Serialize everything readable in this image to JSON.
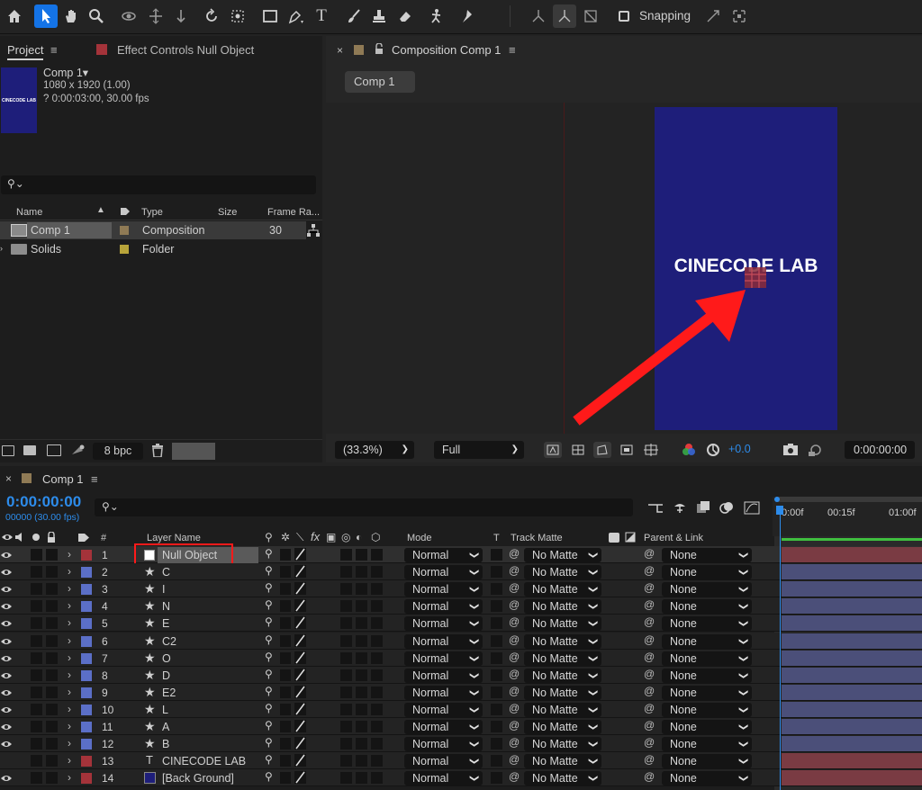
{
  "toolbar": {
    "snapping_label": "Snapping",
    "tools": [
      "home-icon",
      "selection-icon",
      "hand-icon",
      "zoom-icon",
      "orbit-icon",
      "pan-icon",
      "dolly-icon",
      "rotate-icon",
      "anchor-icon",
      "rectangle-icon",
      "pen-icon",
      "type-icon",
      "brush-icon",
      "clone-stamp-icon",
      "eraser-icon",
      "roto-brush-icon",
      "puppet-pin-icon"
    ]
  },
  "project_panel": {
    "tab_project": "Project",
    "tab_effect_controls": "Effect Controls Null Object",
    "thumb_text": "CINECODE LAB",
    "comp_name": "Comp 1▾",
    "comp_dims": "1080 x 1920 (1.00)",
    "comp_duration": "? 0:00:03:00, 30.00 fps",
    "search_placeholder": "",
    "columns": {
      "name": "Name",
      "type": "Type",
      "size": "Size",
      "frame_rate": "Frame Ra..."
    },
    "items": [
      {
        "name": "Comp 1",
        "type": "Composition",
        "frame_rate": "30"
      },
      {
        "name": "Solids",
        "type": "Folder",
        "frame_rate": ""
      }
    ],
    "bpc": "8 bpc"
  },
  "composition_panel": {
    "tab_title": "Composition Comp 1",
    "breadcrumb": "Comp 1",
    "overlay_text": "CINECODE LAB",
    "zoom": "(33.3%)",
    "resolution": "Full",
    "exposure": "+0.0",
    "timecode": "0:00:00:00"
  },
  "timeline": {
    "tab_title": "Comp 1",
    "current_time": "0:00:00:00",
    "frame_info": "00000 (30.00 fps)",
    "ruler": [
      "0:00f",
      "00:15f",
      "01:00f"
    ],
    "columns": {
      "num": "#",
      "layer_name": "Layer Name",
      "mode": "Mode",
      "t": "T",
      "track_matte": "Track Matte",
      "parent": "Parent & Link"
    },
    "layers": [
      {
        "num": "1",
        "name": "Null Object",
        "type": "null",
        "mode": "Normal",
        "matte": "No Matte",
        "parent": "None",
        "label_color": "#a4333a"
      },
      {
        "num": "2",
        "name": "C",
        "type": "shape",
        "mode": "Normal",
        "matte": "No Matte",
        "parent": "None",
        "label_color": "#5b6fc7"
      },
      {
        "num": "3",
        "name": "I",
        "type": "shape",
        "mode": "Normal",
        "matte": "No Matte",
        "parent": "None",
        "label_color": "#5b6fc7"
      },
      {
        "num": "4",
        "name": "N",
        "type": "shape",
        "mode": "Normal",
        "matte": "No Matte",
        "parent": "None",
        "label_color": "#5b6fc7"
      },
      {
        "num": "5",
        "name": "E",
        "type": "shape",
        "mode": "Normal",
        "matte": "No Matte",
        "parent": "None",
        "label_color": "#5b6fc7"
      },
      {
        "num": "6",
        "name": "C2",
        "type": "shape",
        "mode": "Normal",
        "matte": "No Matte",
        "parent": "None",
        "label_color": "#5b6fc7"
      },
      {
        "num": "7",
        "name": "O",
        "type": "shape",
        "mode": "Normal",
        "matte": "No Matte",
        "parent": "None",
        "label_color": "#5b6fc7"
      },
      {
        "num": "8",
        "name": "D",
        "type": "shape",
        "mode": "Normal",
        "matte": "No Matte",
        "parent": "None",
        "label_color": "#5b6fc7"
      },
      {
        "num": "9",
        "name": "E2",
        "type": "shape",
        "mode": "Normal",
        "matte": "No Matte",
        "parent": "None",
        "label_color": "#5b6fc7"
      },
      {
        "num": "10",
        "name": "L",
        "type": "shape",
        "mode": "Normal",
        "matte": "No Matte",
        "parent": "None",
        "label_color": "#5b6fc7"
      },
      {
        "num": "11",
        "name": "A",
        "type": "shape",
        "mode": "Normal",
        "matte": "No Matte",
        "parent": "None",
        "label_color": "#5b6fc7"
      },
      {
        "num": "12",
        "name": "B",
        "type": "shape",
        "mode": "Normal",
        "matte": "No Matte",
        "parent": "None",
        "label_color": "#5b6fc7"
      },
      {
        "num": "13",
        "name": "CINECODE LAB",
        "type": "text",
        "mode": "Normal",
        "matte": "No Matte",
        "parent": "None",
        "label_color": "#a4333a"
      },
      {
        "num": "14",
        "name": "[Back Ground]",
        "type": "solid",
        "mode": "Normal",
        "matte": "No Matte",
        "parent": "None",
        "label_color": "#a4333a"
      }
    ]
  },
  "colors": {
    "accent": "#1473e6",
    "timecode_blue": "#2d8ceb",
    "comp_bg": "#1e1e7a",
    "highlight_red": "#ff1a1a"
  }
}
